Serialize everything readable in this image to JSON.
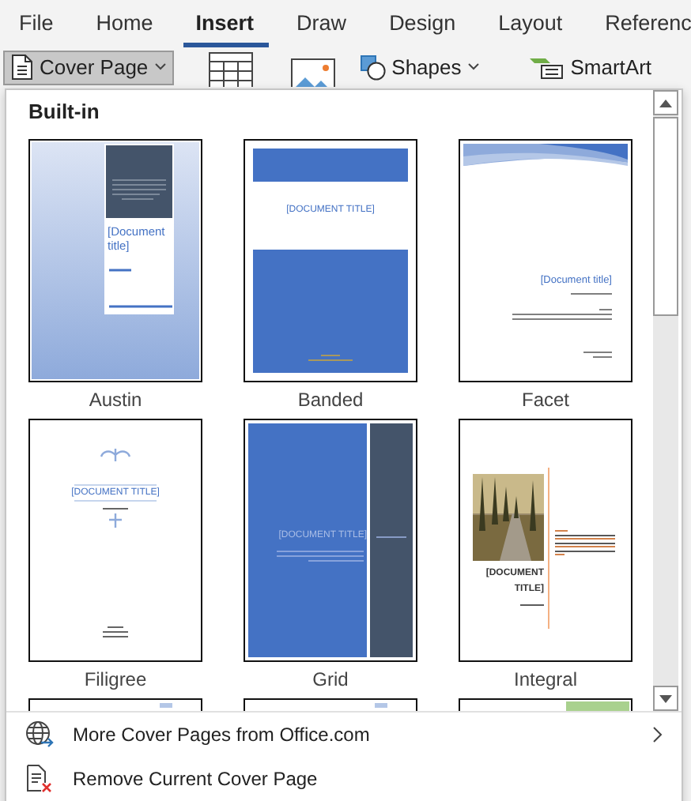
{
  "ribbon_tabs": [
    {
      "label": "File",
      "selected": false
    },
    {
      "label": "Home",
      "selected": false
    },
    {
      "label": "Insert",
      "selected": true
    },
    {
      "label": "Draw",
      "selected": false
    },
    {
      "label": "Design",
      "selected": false
    },
    {
      "label": "Layout",
      "selected": false
    },
    {
      "label": "Referenc",
      "selected": false
    }
  ],
  "toolbar": [
    {
      "kind": "cover",
      "label": "Cover Page",
      "pressed": true
    },
    {
      "kind": "table",
      "pressed": false
    },
    {
      "kind": "picture",
      "pressed": false
    },
    {
      "kind": "shapes",
      "label": "Shapes",
      "pressed": false
    },
    {
      "kind": "smartart",
      "label": "SmartArt",
      "pressed": false
    }
  ],
  "gallery": {
    "heading": "Built-in",
    "items": [
      {
        "kind": "austin",
        "label": "Austin",
        "title": "[Document title]"
      },
      {
        "kind": "banded",
        "label": "Banded",
        "title": "[DOCUMENT TITLE]"
      },
      {
        "kind": "facet",
        "label": "Facet",
        "title": "[Document title]"
      },
      {
        "kind": "filigree",
        "label": "Filigree",
        "title": "[DOCUMENT TITLE]"
      },
      {
        "kind": "grid",
        "label": "Grid",
        "title": "[DOCUMENT TITLE]"
      },
      {
        "kind": "integral",
        "label": "Integral",
        "title": "[DOCUMENT TITLE]"
      },
      {
        "kind": "cut"
      },
      {
        "kind": "cut"
      },
      {
        "kind": "cut-green"
      }
    ]
  },
  "menu_items": [
    {
      "kind": "online",
      "label": "More Cover Pages from Office.com",
      "submenu": true
    },
    {
      "kind": "remove",
      "label": "Remove Current Cover Page",
      "submenu": false
    }
  ]
}
